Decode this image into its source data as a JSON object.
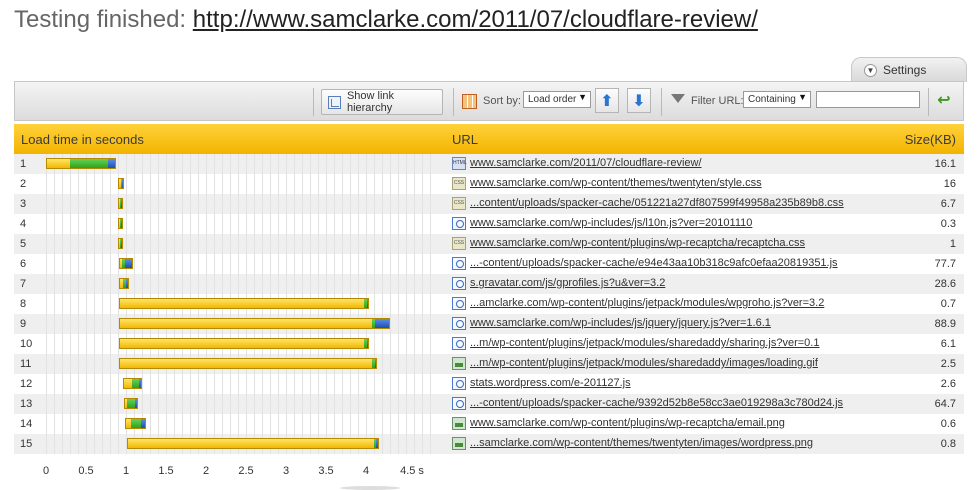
{
  "title": {
    "prefix": "Testing finished:",
    "url": "http://www.samclarke.com/2011/07/cloudflare-review/"
  },
  "settings_tab": {
    "label": "Settings"
  },
  "toolbar": {
    "show_hierarchy_label": "Show link hierarchy",
    "sort_by_label": "Sort by:",
    "sort_by_value": "Load order",
    "filter_label": "Filter URL:",
    "filter_mode_value": "Containing",
    "filter_input_value": ""
  },
  "header": {
    "load_time": "Load time in seconds",
    "url": "URL",
    "size": "Size(KB)"
  },
  "colors": {
    "header": "#f3b300",
    "dns": "#f2b800",
    "connect": "#2ea21c",
    "receive": "#1c4fb0"
  },
  "rows": [
    {
      "num": "1",
      "type": "html",
      "url": "www.samclarke.com/2011/07/cloudflare-review/",
      "size": "16.1"
    },
    {
      "num": "2",
      "type": "css",
      "url": "www.samclarke.com/wp-content/themes/twentyten/style.css",
      "size": "16"
    },
    {
      "num": "3",
      "type": "css",
      "url": "...content/uploads/spacker-cache/051221a27df807599f49958a235b89b8.css",
      "size": "6.7"
    },
    {
      "num": "4",
      "type": "js",
      "url": "www.samclarke.com/wp-includes/js/l10n.js?ver=20101110",
      "size": "0.3"
    },
    {
      "num": "5",
      "type": "css",
      "url": "www.samclarke.com/wp-content/plugins/wp-recaptcha/recaptcha.css",
      "size": "1"
    },
    {
      "num": "6",
      "type": "js",
      "url": "...-content/uploads/spacker-cache/e94e43aa10b318c9afc0efaa20819351.js",
      "size": "77.7"
    },
    {
      "num": "7",
      "type": "js",
      "url": "s.gravatar.com/js/gprofiles.js?u&ver=3.2",
      "size": "28.6"
    },
    {
      "num": "8",
      "type": "js",
      "url": "...amclarke.com/wp-content/plugins/jetpack/modules/wpgroho.js?ver=3.2",
      "size": "0.7"
    },
    {
      "num": "9",
      "type": "js",
      "url": "www.samclarke.com/wp-includes/js/jquery/jquery.js?ver=1.6.1",
      "size": "88.9"
    },
    {
      "num": "10",
      "type": "js",
      "url": "...m/wp-content/plugins/jetpack/modules/sharedaddy/sharing.js?ver=0.1",
      "size": "6.1"
    },
    {
      "num": "11",
      "type": "img",
      "url": "...m/wp-content/plugins/jetpack/modules/sharedaddy/images/loading.gif",
      "size": "2.5"
    },
    {
      "num": "12",
      "type": "js",
      "url": "stats.wordpress.com/e-201127.js",
      "size": "2.6"
    },
    {
      "num": "13",
      "type": "js",
      "url": "...-content/uploads/spacker-cache/9392d52b8e58cc3ae019298a3c780d24.js",
      "size": "64.7"
    },
    {
      "num": "14",
      "type": "img",
      "url": "www.samclarke.com/wp-content/plugins/wp-recaptcha/email.png",
      "size": "0.6"
    },
    {
      "num": "15",
      "type": "img",
      "url": "...samclarke.com/wp-content/themes/twentyten/images/wordpress.png",
      "size": "0.8"
    }
  ],
  "chart_data": {
    "type": "bar",
    "xlim": [
      0,
      4.8
    ],
    "ticks": [
      "0",
      "0.5",
      "1",
      "1.5",
      "2",
      "2.5",
      "3",
      "3.5",
      "4",
      "4.5 s"
    ],
    "tick_values": [
      0,
      0.5,
      1,
      1.5,
      2,
      2.5,
      3,
      3.5,
      4,
      4.5
    ],
    "bars": [
      {
        "row": 1,
        "segments": [
          {
            "color": "y",
            "start": 0.0,
            "end": 0.3
          },
          {
            "color": "g",
            "start": 0.3,
            "end": 0.78
          },
          {
            "color": "b",
            "start": 0.78,
            "end": 0.88
          }
        ]
      },
      {
        "row": 2,
        "segments": [
          {
            "color": "y",
            "start": 0.9,
            "end": 0.93
          },
          {
            "color": "g",
            "start": 0.93,
            "end": 0.96
          },
          {
            "color": "b",
            "start": 0.96,
            "end": 0.98
          }
        ]
      },
      {
        "row": 3,
        "segments": [
          {
            "color": "y",
            "start": 0.9,
            "end": 0.93
          },
          {
            "color": "g",
            "start": 0.93,
            "end": 0.95
          },
          {
            "color": "b",
            "start": 0.95,
            "end": 0.96
          }
        ]
      },
      {
        "row": 4,
        "segments": [
          {
            "color": "y",
            "start": 0.9,
            "end": 0.93
          },
          {
            "color": "g",
            "start": 0.93,
            "end": 0.95
          },
          {
            "color": "b",
            "start": 0.95,
            "end": 0.96
          }
        ]
      },
      {
        "row": 5,
        "segments": [
          {
            "color": "y",
            "start": 0.9,
            "end": 0.93
          },
          {
            "color": "g",
            "start": 0.93,
            "end": 0.95
          },
          {
            "color": "b",
            "start": 0.95,
            "end": 0.96
          }
        ]
      },
      {
        "row": 6,
        "segments": [
          {
            "color": "y",
            "start": 0.91,
            "end": 0.94
          },
          {
            "color": "g",
            "start": 0.94,
            "end": 0.98
          },
          {
            "color": "b",
            "start": 0.98,
            "end": 1.09
          }
        ]
      },
      {
        "row": 7,
        "segments": [
          {
            "color": "y",
            "start": 0.91,
            "end": 0.96
          },
          {
            "color": "g",
            "start": 0.96,
            "end": 1.0
          },
          {
            "color": "b",
            "start": 1.0,
            "end": 1.04
          }
        ]
      },
      {
        "row": 8,
        "segments": [
          {
            "color": "y",
            "start": 0.91,
            "end": 3.99
          },
          {
            "color": "g",
            "start": 3.99,
            "end": 4.02
          },
          {
            "color": "b",
            "start": 4.02,
            "end": 4.04
          }
        ]
      },
      {
        "row": 9,
        "segments": [
          {
            "color": "y",
            "start": 0.91,
            "end": 4.08
          },
          {
            "color": "g",
            "start": 4.08,
            "end": 4.12
          },
          {
            "color": "b",
            "start": 4.12,
            "end": 4.3
          }
        ]
      },
      {
        "row": 10,
        "segments": [
          {
            "color": "y",
            "start": 0.91,
            "end": 3.99
          },
          {
            "color": "g",
            "start": 3.99,
            "end": 4.02
          },
          {
            "color": "b",
            "start": 4.02,
            "end": 4.04
          }
        ]
      },
      {
        "row": 11,
        "segments": [
          {
            "color": "y",
            "start": 0.91,
            "end": 4.09
          },
          {
            "color": "g",
            "start": 4.09,
            "end": 4.12
          },
          {
            "color": "b",
            "start": 4.12,
            "end": 4.14
          }
        ]
      },
      {
        "row": 12,
        "segments": [
          {
            "color": "y",
            "start": 0.96,
            "end": 1.08
          },
          {
            "color": "g",
            "start": 1.08,
            "end": 1.17
          },
          {
            "color": "b",
            "start": 1.17,
            "end": 1.2
          }
        ]
      },
      {
        "row": 13,
        "segments": [
          {
            "color": "y",
            "start": 0.97,
            "end": 1.0
          },
          {
            "color": "g",
            "start": 1.0,
            "end": 1.12
          },
          {
            "color": "b",
            "start": 1.12,
            "end": 1.15
          }
        ]
      },
      {
        "row": 14,
        "segments": [
          {
            "color": "y",
            "start": 0.99,
            "end": 1.05
          },
          {
            "color": "g",
            "start": 1.05,
            "end": 1.2
          },
          {
            "color": "b",
            "start": 1.2,
            "end": 1.25
          }
        ]
      },
      {
        "row": 15,
        "segments": [
          {
            "color": "y",
            "start": 1.01,
            "end": 4.11
          },
          {
            "color": "g",
            "start": 4.11,
            "end": 4.14
          },
          {
            "color": "b",
            "start": 4.14,
            "end": 4.16
          }
        ]
      }
    ]
  }
}
